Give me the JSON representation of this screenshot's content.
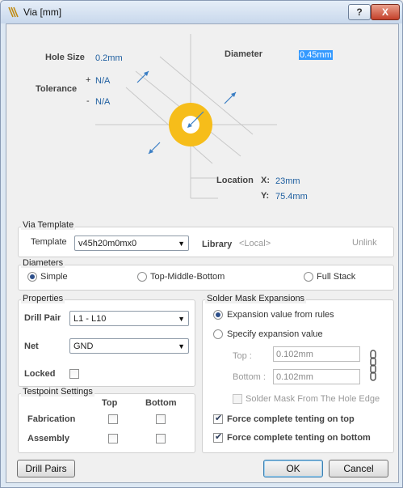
{
  "window": {
    "title": "Via [mm]",
    "help_label": "?",
    "close_label": "X"
  },
  "diagram": {
    "hole_size_label": "Hole Size",
    "hole_size_value": "0.2mm",
    "tolerance_label": "Tolerance",
    "tol_plus_sign": "+",
    "tol_plus_value": "N/A",
    "tol_minus_sign": "-",
    "tol_minus_value": "N/A",
    "diameter_label": "Diameter",
    "diameter_value": "0.45mm",
    "location_label": "Location",
    "x_label": "X:",
    "x_value": "23mm",
    "y_label": "Y:",
    "y_value": "75.4mm"
  },
  "via_template": {
    "section_title": "Via Template",
    "template_label": "Template",
    "template_value": "v45h20m0mx0",
    "library_label": "Library",
    "library_value": "<Local>",
    "unlink_label": "Unlink"
  },
  "diameters": {
    "section_title": "Diameters",
    "simple_label": "Simple",
    "tmb_label": "Top-Middle-Bottom",
    "full_stack_label": "Full Stack",
    "selected": "Simple"
  },
  "properties": {
    "section_title": "Properties",
    "drill_pair_label": "Drill Pair",
    "drill_pair_value": "L1 - L10",
    "net_label": "Net",
    "net_value": "GND",
    "locked_label": "Locked",
    "locked": false
  },
  "testpoint": {
    "section_title": "Testpoint Settings",
    "top_header": "Top",
    "bottom_header": "Bottom",
    "fabrication_label": "Fabrication",
    "assembly_label": "Assembly"
  },
  "solder_mask": {
    "section_title": "Solder Mask Expansions",
    "from_rules_label": "Expansion value from rules",
    "specify_label": "Specify expansion value",
    "top_label": "Top :",
    "top_value": "0.102mm",
    "bottom_label": "Bottom :",
    "bottom_value": "0.102mm",
    "from_hole_label": "Solder Mask From The Hole Edge",
    "tent_top_label": "Force complete tenting on top",
    "tent_bottom_label": "Force complete tenting on bottom",
    "tent_top": true,
    "tent_bottom": true
  },
  "buttons": {
    "drill_pairs": "Drill Pairs",
    "ok": "OK",
    "cancel": "Cancel"
  },
  "colors": {
    "via_ring": "#f6bd1a",
    "accent_blue": "#1f5fa0",
    "selection": "#3399ff"
  }
}
